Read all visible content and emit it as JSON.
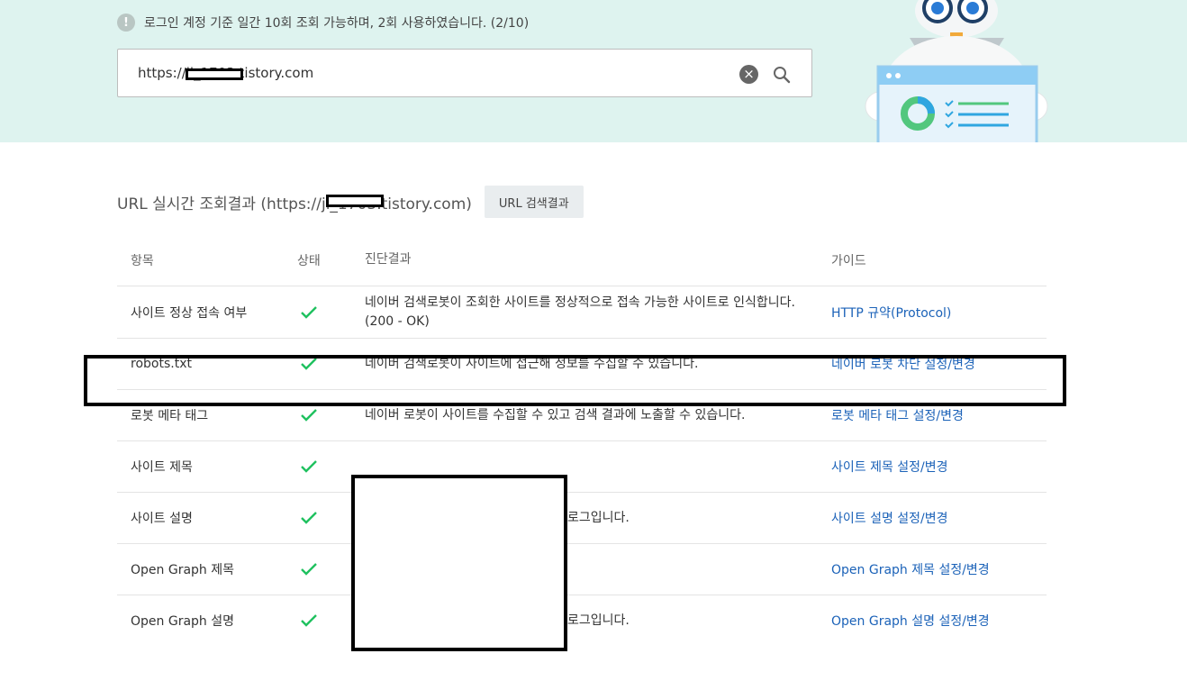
{
  "notice": {
    "icon": "exclamation-icon",
    "text": "로그인 계정 기준 일간 10회 조회 가능하며, 2회 사용하였습니다. (2/10)"
  },
  "search": {
    "value": "https://ji_1703.tistory.com"
  },
  "result": {
    "title": "URL 실시간 조회결과 (https://ji_1703.tistory.com)",
    "button_label": "URL 검색결과"
  },
  "table": {
    "headers": {
      "item": "항목",
      "status": "상태",
      "diagnosis": "진단결과",
      "guide": "가이드"
    },
    "rows": [
      {
        "item": "사이트 정상 접속 여부",
        "diagnosis": "네이버 검색로봇이 조회한 사이트를 정상적으로 접속 가능한 사이트로 인식합니다. (200 - OK)",
        "guide": "HTTP 규약(Protocol)"
      },
      {
        "item": "robots.txt",
        "diagnosis": "네이버 검색로봇이 사이트에 접근해 정보를 수집할 수 있습니다.",
        "guide": "네이버 로봇 차단 설정/변경"
      },
      {
        "item": "로봇 메타 태그",
        "diagnosis": "네이버 로봇이 사이트를 수집할 수 있고 검색 결과에 노출할 수 있습니다.",
        "guide": "로봇 메타 태그 설정/변경"
      },
      {
        "item": "사이트 제목",
        "diagnosis": "",
        "guide": "사이트 제목 설정/변경"
      },
      {
        "item": "사이트 설명",
        "diagnosis": "로그입니다.",
        "guide": "사이트 설명 설정/변경"
      },
      {
        "item": "Open Graph 제목",
        "diagnosis": "",
        "guide": "Open Graph 제목 설정/변경"
      },
      {
        "item": "Open Graph 설명",
        "diagnosis": "로그입니다.",
        "guide": "Open Graph 설명 설정/변경"
      }
    ]
  },
  "colors": {
    "hero_bg": "#def3ef",
    "check_green": "#1fc15f",
    "link_blue": "#1b62b8"
  },
  "icons": {
    "status": "check-icon",
    "clear": "clear-icon",
    "search": "search-icon"
  }
}
